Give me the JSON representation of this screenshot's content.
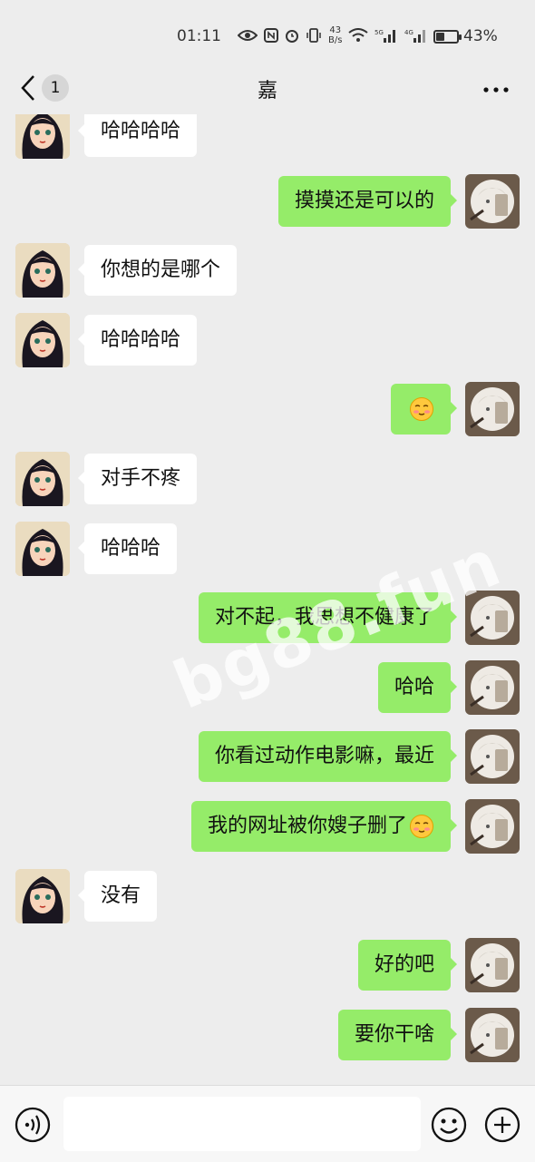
{
  "status_bar": {
    "time": "01:11",
    "net_speed_value": "43",
    "net_speed_unit": "B/s",
    "battery_percent": "43%",
    "battery_level": 0.43
  },
  "nav": {
    "unread_count": "1",
    "title": "嘉"
  },
  "colors": {
    "background": "#ededed",
    "sent_bubble": "#95ec69",
    "received_bubble": "#ffffff"
  },
  "messages": [
    {
      "side": "left",
      "text": "哈哈哈哈"
    },
    {
      "side": "right",
      "text": "摸摸还是可以的"
    },
    {
      "side": "left",
      "text": "你想的是哪个"
    },
    {
      "side": "left",
      "text": "哈哈哈哈"
    },
    {
      "side": "right",
      "text": "",
      "emoji": "blush-emoji"
    },
    {
      "side": "left",
      "text": "对手不疼"
    },
    {
      "side": "left",
      "text": "哈哈哈"
    },
    {
      "side": "right",
      "text": "对不起，我思想不健康了"
    },
    {
      "side": "right",
      "text": "哈哈"
    },
    {
      "side": "right",
      "text": "你看过动作电影嘛，最近"
    },
    {
      "side": "right",
      "text": "我的网址被你嫂子删了",
      "emoji": "blush-emoji"
    },
    {
      "side": "left",
      "text": "没有"
    },
    {
      "side": "right",
      "text": "好的吧"
    },
    {
      "side": "right",
      "text": "要你干啥"
    }
  ],
  "watermark": "bg88.fun",
  "input_bar": {
    "voice_icon": "voice-icon",
    "emoji_icon": "emoji-icon",
    "plus_icon": "plus-icon"
  }
}
